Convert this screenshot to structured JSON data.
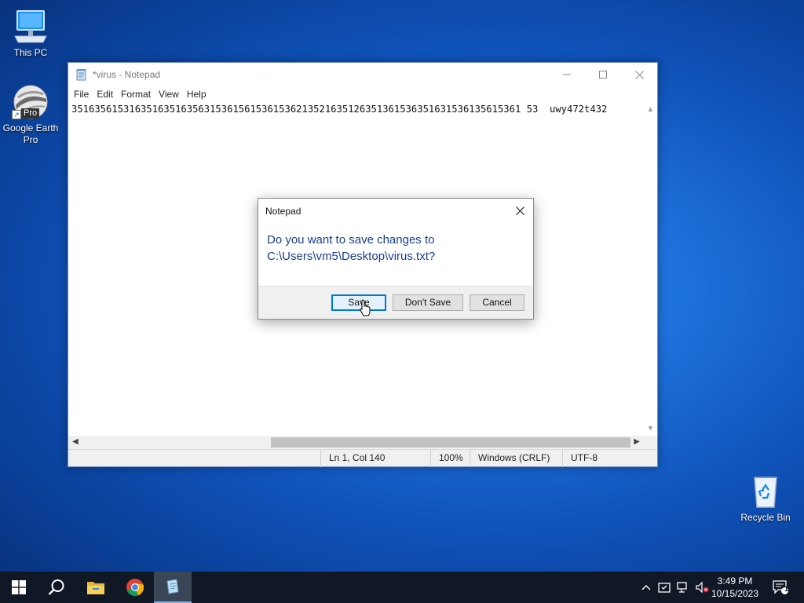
{
  "desktop": {
    "icons": [
      {
        "label": "This PC"
      },
      {
        "label": "Google Earth Pro",
        "badge": "Pro"
      },
      {
        "label": "Recycle Bin"
      }
    ]
  },
  "notepad": {
    "title": "*virus - Notepad",
    "menu": [
      "File",
      "Edit",
      "Format",
      "View",
      "Help"
    ],
    "content": "351635615316351635163563153615615361536213521635126351361536351631536135615361 53  uwy472t432",
    "status": {
      "position": "Ln 1, Col 140",
      "zoom": "100%",
      "line_ending": "Windows (CRLF)",
      "encoding": "UTF-8"
    }
  },
  "dialog": {
    "title": "Notepad",
    "message_line1": "Do you want to save changes to",
    "message_line2": "C:\\Users\\vm5\\Desktop\\virus.txt?",
    "buttons": {
      "save": "Save",
      "dont_save": "Don't Save",
      "cancel": "Cancel"
    }
  },
  "taskbar": {
    "time": "3:49 PM",
    "date": "10/15/2023",
    "notification_count": "1"
  },
  "colors": {
    "accent": "#0078d7",
    "dialog_text": "#1a3d8f",
    "taskbar": "#101826"
  }
}
